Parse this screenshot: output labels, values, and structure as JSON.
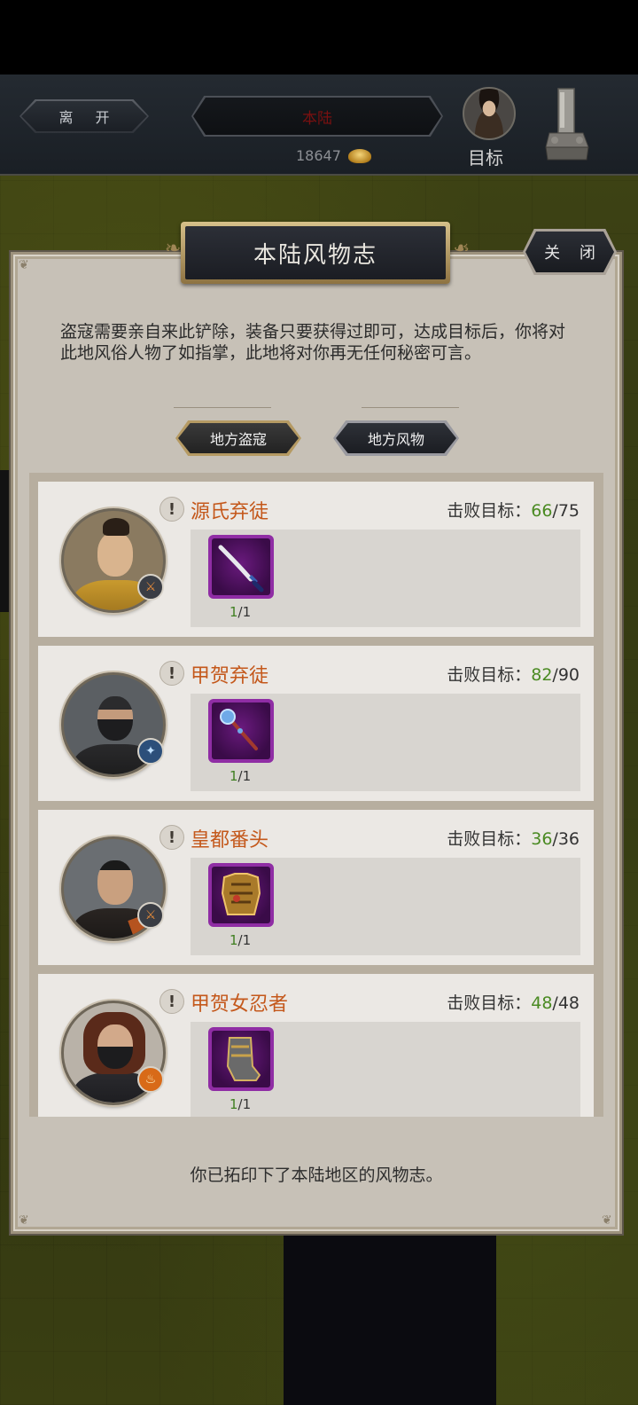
{
  "hud": {
    "leave_label": "离 开",
    "region_name": "本陆",
    "coins": "18647",
    "target_label": "目标"
  },
  "panel": {
    "title": "本陆风物志",
    "close_label": "关 闭",
    "intro": "盗寇需要亲自来此铲除，装备只要获得过即可，达成目标后，你将对此地风俗人物了如指掌，此地将对你再无任何秘密可言。",
    "tabs": [
      {
        "label": "地方盗寇",
        "active": true
      },
      {
        "label": "地方风物",
        "active": false
      }
    ],
    "defeat_label": "击败目标：",
    "bandits": [
      {
        "name": "源氏弃徒",
        "defeated": "66",
        "total": "/75",
        "item_icon": "katana-icon",
        "item_have": "1",
        "item_total": "/1",
        "portrait": "monk-portrait",
        "badge_icon": "sword-badge-icon"
      },
      {
        "name": "甲贺弃徒",
        "defeated": "82",
        "total": "/90",
        "item_icon": "mace-icon",
        "item_have": "1",
        "item_total": "/1",
        "portrait": "ninja-portrait",
        "badge_icon": "water-badge-icon"
      },
      {
        "name": "皇都番头",
        "defeated": "36",
        "total": "/36",
        "item_icon": "armor-icon",
        "item_have": "1",
        "item_total": "/1",
        "portrait": "pirate-portrait",
        "badge_icon": "sword-badge-icon"
      },
      {
        "name": "甲贺女忍者",
        "defeated": "48",
        "total": "/48",
        "item_icon": "greaves-icon",
        "item_have": "1",
        "item_total": "/1",
        "portrait": "kunoichi-portrait",
        "badge_icon": "fire-badge-icon"
      }
    ],
    "footer": "你已拓印下了本陆地区的风物志。"
  },
  "colors": {
    "bandit_name": "#c4581b",
    "count_green": "#4a8a22",
    "item_purple": "#8f2da4",
    "panel_bg": "#c7c1b7"
  }
}
